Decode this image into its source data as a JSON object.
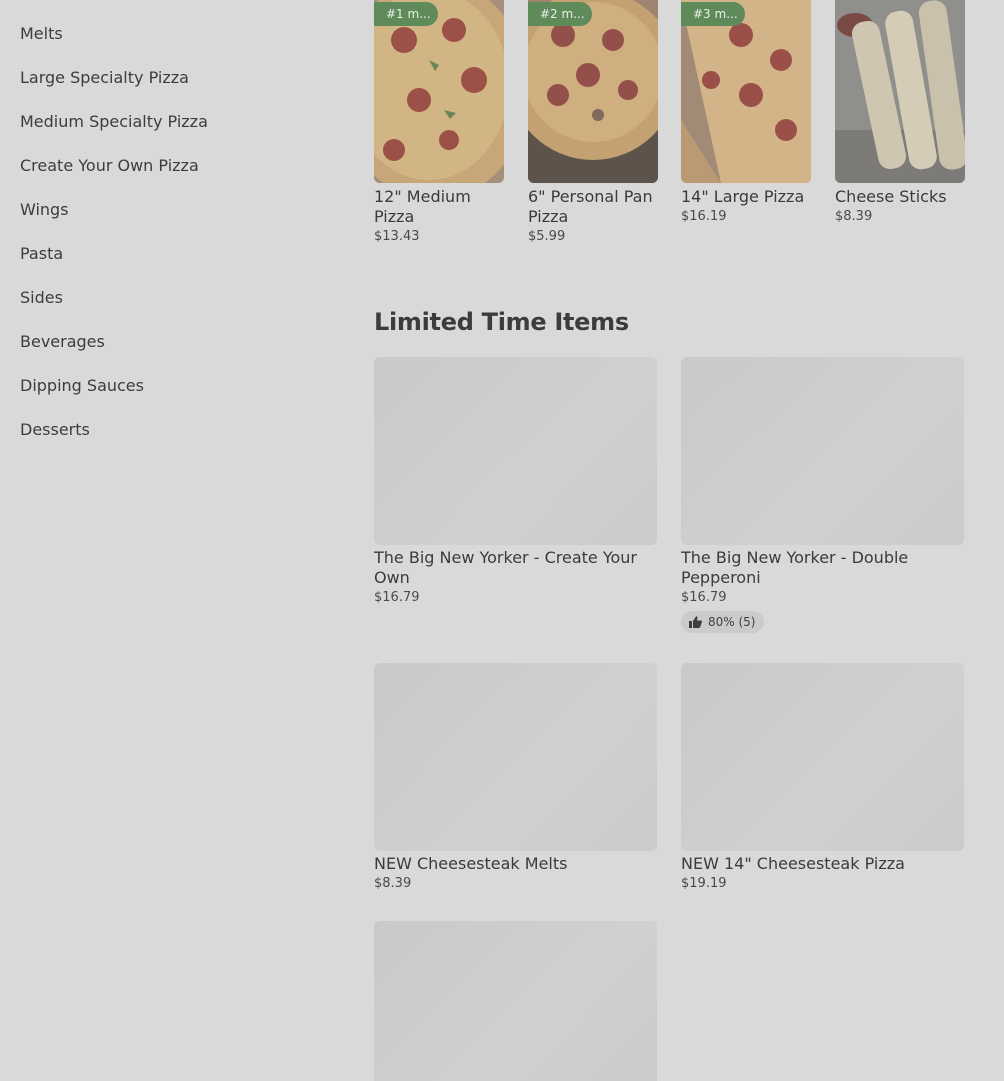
{
  "sidebar": {
    "items": [
      {
        "label": "Melts"
      },
      {
        "label": "Large Specialty Pizza"
      },
      {
        "label": "Medium Specialty Pizza"
      },
      {
        "label": "Create Your Own Pizza"
      },
      {
        "label": "Wings"
      },
      {
        "label": "Pasta"
      },
      {
        "label": "Sides"
      },
      {
        "label": "Beverages"
      },
      {
        "label": "Dipping Sauces"
      },
      {
        "label": "Desserts"
      }
    ]
  },
  "popular": [
    {
      "badge": "#1 m...",
      "name": "12\" Medium Pizza",
      "price": "$13.43"
    },
    {
      "badge": "#2 m...",
      "name": "6\" Personal Pan Pizza",
      "price": "$5.99"
    },
    {
      "badge": "#3 m...",
      "name": "14\" Large Pizza",
      "price": "$16.19"
    },
    {
      "badge": "",
      "name": "Cheese Sticks",
      "price": "$8.39"
    }
  ],
  "limited": {
    "title": "Limited Time Items",
    "items": [
      {
        "name": "The Big New Yorker - Create Your Own",
        "price": "$16.79"
      },
      {
        "name": "The Big New Yorker - Double Pepperoni",
        "price": "$16.79",
        "rating": "80% (5)"
      },
      {
        "name": "NEW Cheesesteak Melts",
        "price": "$8.39"
      },
      {
        "name": "NEW 14\" Cheesesteak Pizza",
        "price": "$19.19"
      }
    ]
  },
  "icons": {
    "rating": "thumbs-up-icon"
  }
}
